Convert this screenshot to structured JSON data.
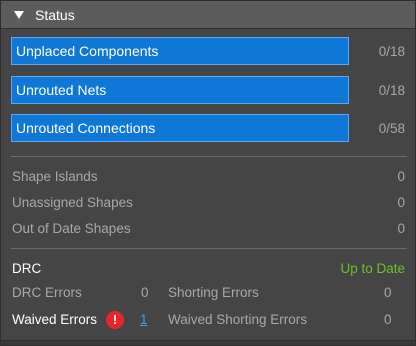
{
  "header": {
    "title": "Status",
    "toggle_icon": "triangle-down-icon"
  },
  "bars": [
    {
      "label": "Unplaced Components",
      "count": "0/18"
    },
    {
      "label": "Unrouted Nets",
      "count": "0/18"
    },
    {
      "label": "Unrouted Connections",
      "count": "0/58"
    }
  ],
  "shapes": [
    {
      "label": "Shape Islands",
      "value": "0"
    },
    {
      "label": "Unassigned Shapes",
      "value": "0"
    },
    {
      "label": "Out of Date Shapes",
      "value": "0"
    }
  ],
  "drc": {
    "label": "DRC",
    "status": "Up to Date",
    "status_color": "#6fc12a",
    "drc_errors_label": "DRC Errors",
    "drc_errors_value": "0",
    "shorting_errors_label": "Shorting Errors",
    "shorting_errors_value": "0",
    "waived_errors_label": "Waived Errors",
    "waived_errors_icon": "!",
    "waived_errors_value": "1",
    "waived_shorting_label": "Waived Shorting Errors",
    "waived_shorting_value": "0"
  },
  "colors": {
    "accent_bar": "#0f78d6",
    "panel_bg": "#454545",
    "header_bg": "#5c5c5c",
    "warning": "#e8252b",
    "link": "#3a9cf5"
  }
}
